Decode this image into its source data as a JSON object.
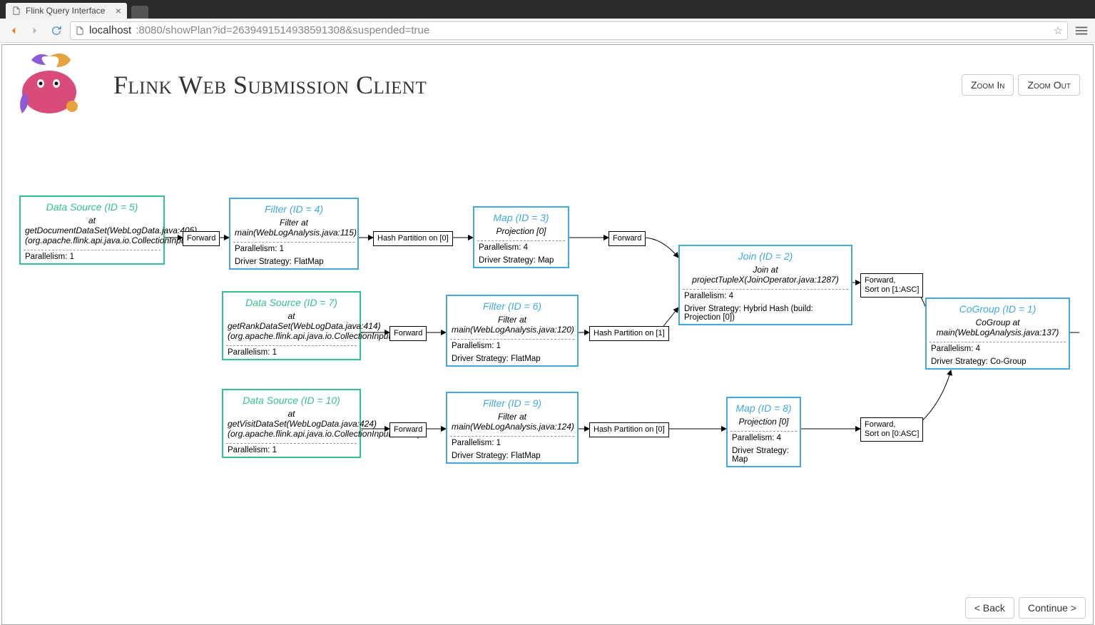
{
  "tab": {
    "title": "Flink Query Interface"
  },
  "url": {
    "host": "localhost",
    "rest": ":8080/showPlan?id=2639491514938591308&suspended=true"
  },
  "page": {
    "title": "Flink Web Submission Client",
    "zoomIn": "Zoom In",
    "zoomOut": "Zoom Out",
    "back": "< Back",
    "continue": "Continue >"
  },
  "nodes": {
    "n5": {
      "title": "Data Source (ID = 5)",
      "sub": "at getDocumentDataSet(WebLogData.java:405) (org.apache.flink.api.java.io.CollectionInputFormat)",
      "r1": "Parallelism: 1"
    },
    "n4": {
      "title": "Filter (ID = 4)",
      "sub": "Filter at main(WebLogAnalysis.java:115)",
      "r1": "Parallelism: 1",
      "r2": "Driver Strategy: FlatMap"
    },
    "n3": {
      "title": "Map (ID = 3)",
      "sub": "Projection [0]",
      "r1": "Parallelism: 4",
      "r2": "Driver Strategy: Map"
    },
    "n2": {
      "title": "Join (ID = 2)",
      "sub": "Join at projectTupleX(JoinOperator.java:1287)",
      "r1": "Parallelism: 4",
      "r2": "Driver Strategy: Hybrid Hash (build: Projection [0])"
    },
    "n7": {
      "title": "Data Source (ID = 7)",
      "sub": "at getRankDataSet(WebLogData.java:414) (org.apache.flink.api.java.io.CollectionInputFormat)",
      "r1": "Parallelism: 1"
    },
    "n6": {
      "title": "Filter (ID = 6)",
      "sub": "Filter at main(WebLogAnalysis.java:120)",
      "r1": "Parallelism: 1",
      "r2": "Driver Strategy: FlatMap"
    },
    "n10": {
      "title": "Data Source (ID = 10)",
      "sub": "at getVisitDataSet(WebLogData.java:424) (org.apache.flink.api.java.io.CollectionInputFormat)",
      "r1": "Parallelism: 1"
    },
    "n9": {
      "title": "Filter (ID = 9)",
      "sub": "Filter at main(WebLogAnalysis.java:124)",
      "r1": "Parallelism: 1",
      "r2": "Driver Strategy: FlatMap"
    },
    "n8": {
      "title": "Map (ID = 8)",
      "sub": "Projection [0]",
      "r1": "Parallelism: 4",
      "r2": "Driver Strategy: Map"
    },
    "n1": {
      "title": "CoGroup (ID = 1)",
      "sub": "CoGroup at main(WebLogAnalysis.java:137)",
      "r1": "Parallelism: 4",
      "r2": "Driver Strategy: Co-Group"
    }
  },
  "edges": {
    "e54": "Forward",
    "e43": "Hash Partition on [0]",
    "e32": "Forward",
    "e76": "Forward",
    "e62": "Hash Partition on [1]",
    "e109": "Forward",
    "e98": "Hash Partition on [0]",
    "e21a": "Forward,",
    "e21b": "Sort on [1:ASC]",
    "e81a": "Forward,",
    "e81b": "Sort on [0:ASC]"
  }
}
